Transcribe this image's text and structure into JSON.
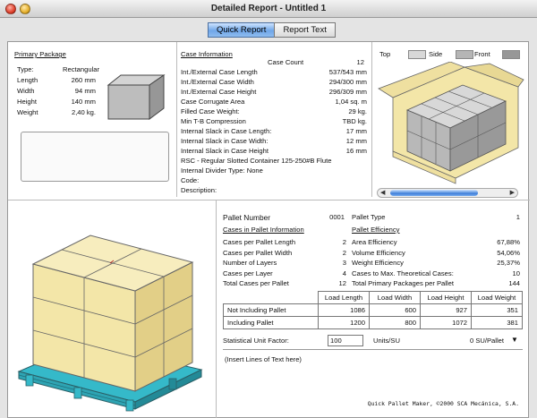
{
  "window": {
    "title": "Detailed Report - Untitled 1"
  },
  "tabs": [
    {
      "label": "Quick Report",
      "active": true
    },
    {
      "label": "Report Text",
      "active": false
    }
  ],
  "primary_package": {
    "heading": "Primary Package",
    "rows": [
      {
        "label": "Type:",
        "value": "Rectangular"
      },
      {
        "label": "Length",
        "value": "260 mm"
      },
      {
        "label": "Width",
        "value": "94 mm"
      },
      {
        "label": "Height",
        "value": "140 mm"
      },
      {
        "label": "Weight",
        "value": "2,40 kg."
      }
    ]
  },
  "case_info": {
    "heading": "Case Information",
    "count_label": "Case Count",
    "count_value": "12",
    "rows": [
      {
        "label": "Int./External Case Length",
        "value": "537/543 mm"
      },
      {
        "label": "Int./External Case Width",
        "value": "294/300 mm"
      },
      {
        "label": "Int./External Case Height",
        "value": "296/309 mm"
      },
      {
        "label": "Case Corrugate Area",
        "value": "1,04 sq. m"
      },
      {
        "label": "Filled Case Weight:",
        "value": "29 kg."
      },
      {
        "label": "Min T-B Compression",
        "value": "TBD kg."
      },
      {
        "label": "Internal Slack in Case Length:",
        "value": "17 mm"
      },
      {
        "label": "Internal Slack in Case Width:",
        "value": "12 mm"
      },
      {
        "label": "Internal Slack in Case Height",
        "value": "16 mm"
      }
    ],
    "rsc": "RSC - Regular Slotted Container 125-250#B Flute",
    "divider": "Internal Divider Type: None",
    "code_label": "Code:",
    "description_label": "Description:"
  },
  "view_keys": [
    {
      "label": "Top"
    },
    {
      "label": "Side"
    },
    {
      "label": "Front"
    }
  ],
  "view_colors": {
    "top": "#d8d8d8",
    "side": "#b5b5b5",
    "front": "#979797"
  },
  "pallet": {
    "number_label": "Pallet Number",
    "number_value": "0001",
    "type_label": "Pallet Type",
    "type_value": "1",
    "cases_heading": "Cases in Pallet Information",
    "eff_heading": "Pallet Efficiency",
    "cases_rows": [
      {
        "label": "Cases per Pallet Length",
        "value": "2"
      },
      {
        "label": "Cases per Pallet Width",
        "value": "2"
      },
      {
        "label": "Number of Layers",
        "value": "3"
      },
      {
        "label": "Cases per Layer",
        "value": "4"
      },
      {
        "label": "Total Cases per Pallet",
        "value": "12"
      }
    ],
    "eff_rows": [
      {
        "label": "Area Efficiency",
        "value": "67,88%"
      },
      {
        "label": "Volume Efficiency",
        "value": "54,06%"
      },
      {
        "label": "Weight Efficiency",
        "value": "25,37%"
      },
      {
        "label": "Cases to Max. Theoretical Cases:",
        "value": "10"
      },
      {
        "label": "Total Primary Packages per Pallet",
        "value": "144"
      }
    ]
  },
  "loads": {
    "headers": [
      "Load Length",
      "Load Width",
      "Load Height",
      "Load Weight"
    ],
    "rows": [
      {
        "label": "Not Including Pallet",
        "values": [
          "1086",
          "600",
          "927",
          "351"
        ]
      },
      {
        "label": "Including Pallet",
        "values": [
          "1200",
          "800",
          "1072",
          "381"
        ]
      }
    ]
  },
  "su": {
    "label": "Statistical Unit Factor:",
    "value": "100",
    "units": "Units/SU",
    "result": "0 SU/Pallet"
  },
  "notes": {
    "placeholder": "(Insert Lines of Text here)"
  },
  "footer": "Quick Pallet Maker, ©2000 SCA Mecánica, S.A.",
  "colors": {
    "accent": "#6fa6e8",
    "pallet": "#35b9c9",
    "case_fill": "#f3e6a8",
    "case_stroke": "#666"
  }
}
